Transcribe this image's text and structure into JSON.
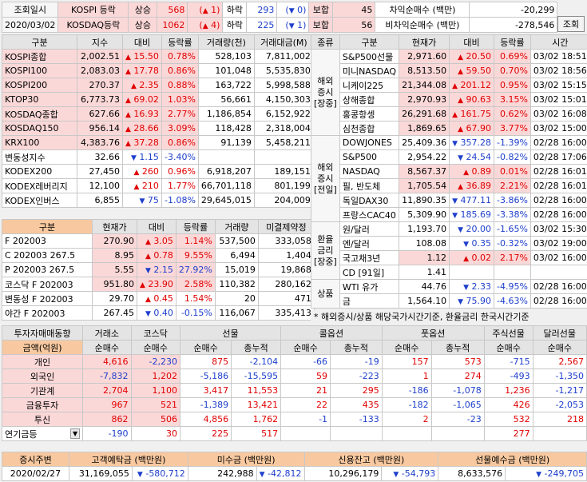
{
  "topbar": {
    "date_label": "조회일시",
    "date_value": "2020/03/02",
    "rows": [
      {
        "name": "KOSPI 등락",
        "up_label": "상승",
        "up": "568",
        "up2": "1",
        "down_label": "하락",
        "down": "293",
        "down2": "0",
        "flat_label": "보합",
        "flat": "45"
      },
      {
        "name": "KOSDAQ등락",
        "up_label": "상승",
        "up": "1062",
        "up2": "4",
        "down_label": "하락",
        "down": "225",
        "down2": "1",
        "flat_label": "보합",
        "flat": "56"
      }
    ],
    "arb1_label": "차익순매수 (백만)",
    "arb1_value": "-20,299",
    "arb2_label": "비차익순매수 (백만)",
    "arb2_value": "-278,546",
    "query_button": "조회"
  },
  "index_table": {
    "headers": [
      "구분",
      "지수",
      "대비",
      "등락률",
      "거래량(천)",
      "거래대금(M)"
    ],
    "rows": [
      {
        "name": "KOSPI종합",
        "value": "2,002.51",
        "dir": "up",
        "chg": "15.50",
        "rate": "0.78%",
        "vol": "528,103",
        "amt": "7,811,002"
      },
      {
        "name": "KOSPI100",
        "value": "2,083.03",
        "dir": "up",
        "chg": "17.78",
        "rate": "0.86%",
        "vol": "101,048",
        "amt": "5,535,830"
      },
      {
        "name": "KOSPI200",
        "value": "270.37",
        "dir": "up",
        "chg": "2.35",
        "rate": "0.88%",
        "vol": "163,722",
        "amt": "5,998,588"
      },
      {
        "name": "KTOP30",
        "value": "6,773.73",
        "dir": "up",
        "chg": "69.02",
        "rate": "1.03%",
        "vol": "56,661",
        "amt": "4,150,303"
      },
      {
        "name": "KOSDAQ종합",
        "value": "627.66",
        "dir": "up",
        "chg": "16.93",
        "rate": "2.77%",
        "vol": "1,186,854",
        "amt": "6,152,922"
      },
      {
        "name": "KOSDAQ150",
        "value": "956.14",
        "dir": "up",
        "chg": "28.66",
        "rate": "3.09%",
        "vol": "118,428",
        "amt": "2,318,004"
      },
      {
        "name": "KRX100",
        "value": "4,383.76",
        "dir": "up",
        "chg": "37.28",
        "rate": "0.86%",
        "vol": "91,139",
        "amt": "5,458,211"
      },
      {
        "name": "변동성지수",
        "value": "32.66",
        "dir": "down",
        "chg": "1.15",
        "rate": "-3.40%",
        "vol": "",
        "amt": ""
      },
      {
        "name": "KODEX200",
        "value": "27,450",
        "dir": "up",
        "chg": "260",
        "rate": "0.96%",
        "vol": "6,918,207",
        "amt": "189,151"
      },
      {
        "name": "KODEX레버리지",
        "value": "12,100",
        "dir": "up",
        "chg": "210",
        "rate": "1.77%",
        "vol": "66,701,118",
        "amt": "801,199"
      },
      {
        "name": "KODEX인버스",
        "value": "6,855",
        "dir": "down",
        "chg": "75",
        "rate": "-1.08%",
        "vol": "29,645,015",
        "amt": "204,009"
      }
    ]
  },
  "futures_table": {
    "headers": [
      "구분",
      "현재가",
      "대비",
      "등락률",
      "거래량",
      "미결제약정"
    ],
    "rows": [
      {
        "name": "F 202003",
        "value": "270.90",
        "dir": "up",
        "chg": "3.05",
        "rate": "1.14%",
        "vol": "537,500",
        "oi": "333,058"
      },
      {
        "name": "C 202003 267.5",
        "value": "8.95",
        "dir": "up",
        "chg": "0.78",
        "rate": "9.55%",
        "vol": "6,494",
        "oi": "1,404"
      },
      {
        "name": "P 202003 267.5",
        "value": "5.55",
        "dir": "down",
        "chg": "2.15",
        "rate": "27.92%",
        "vol": "15,019",
        "oi": "19,868"
      },
      {
        "name": "코스닥 F 202003",
        "value": "951.80",
        "dir": "up",
        "chg": "23.90",
        "rate": "2.58%",
        "vol": "110,382",
        "oi": "280,162"
      },
      {
        "name": "변동성 F 202003",
        "value": "29.70",
        "dir": "up",
        "chg": "0.45",
        "rate": "1.54%",
        "vol": "20",
        "oi": "471"
      },
      {
        "name": "야간 F 202003",
        "value": "267.45",
        "dir": "down",
        "chg": "0.40",
        "rate": "-0.15%",
        "vol": "116,067",
        "oi": "335,413"
      }
    ]
  },
  "world_table": {
    "headers": [
      "종류",
      "구분",
      "현재가",
      "대비",
      "등락률",
      "시간"
    ],
    "groups": [
      {
        "label1": "해외",
        "label2": "증시",
        "label3": "[장중]",
        "rows": [
          {
            "name": "S&P500선물",
            "value": "2,971.60",
            "dir": "up",
            "chg": "20.50",
            "rate": "0.69%",
            "time": "03/02 18:51"
          },
          {
            "name": "미니NASDAQ",
            "value": "8,513.50",
            "dir": "up",
            "chg": "59.50",
            "rate": "0.70%",
            "time": "03/02 18:56"
          },
          {
            "name": "니케이225",
            "value": "21,344.08",
            "dir": "up",
            "chg": "201.12",
            "rate": "0.95%",
            "time": "03/02 15:15"
          },
          {
            "name": "상해종합",
            "value": "2,970.93",
            "dir": "up",
            "chg": "90.63",
            "rate": "3.15%",
            "time": "03/02 15:01"
          },
          {
            "name": "홍콩항셍",
            "value": "26,291.68",
            "dir": "up",
            "chg": "161.75",
            "rate": "0.62%",
            "time": "03/02 16:08"
          },
          {
            "name": "심천종합",
            "value": "1,869.65",
            "dir": "up",
            "chg": "67.90",
            "rate": "3.77%",
            "time": "03/02 15:00"
          }
        ]
      },
      {
        "label1": "해외",
        "label2": "증시",
        "label3": "[전일]",
        "rows": [
          {
            "name": "DOWJONES",
            "value": "25,409.36",
            "dir": "down",
            "chg": "357.28",
            "rate": "-1.39%",
            "time": "02/28 16:00"
          },
          {
            "name": "S&P500",
            "value": "2,954.22",
            "dir": "down",
            "chg": "24.54",
            "rate": "-0.82%",
            "time": "02/28 17:06"
          },
          {
            "name": "NASDAQ",
            "value": "8,567.37",
            "dir": "up",
            "chg": "0.89",
            "rate": "0.01%",
            "time": "02/28 16:01"
          },
          {
            "name": "필, 반도체",
            "value": "1,705.54",
            "dir": "up",
            "chg": "36.89",
            "rate": "2.21%",
            "time": "02/28 16:01"
          },
          {
            "name": "독일DAX30",
            "value": "11,890.35",
            "dir": "down",
            "chg": "477.11",
            "rate": "-3.86%",
            "time": "02/28 16:00"
          },
          {
            "name": "프랑스CAC40",
            "value": "5,309.90",
            "dir": "down",
            "chg": "185.69",
            "rate": "-3.38%",
            "time": "02/28 16:00"
          }
        ]
      },
      {
        "label1": "환율",
        "label2": "금리",
        "label3": "[장중]",
        "rows": [
          {
            "name": "원/달러",
            "value": "1,193.70",
            "dir": "down",
            "chg": "20.00",
            "rate": "-1.65%",
            "time": "03/02 15:30"
          },
          {
            "name": "엔/달러",
            "value": "108.08",
            "dir": "down",
            "chg": "0.35",
            "rate": "-0.32%",
            "time": "03/02 19:00"
          },
          {
            "name": "국고채3년",
            "value": "1.12",
            "dir": "up",
            "chg": "0.02",
            "rate": "2.17%",
            "time": "03/02 16:00"
          },
          {
            "name": "CD [91일]",
            "value": "1.41",
            "dir": "",
            "chg": "",
            "rate": "",
            "time": ""
          }
        ]
      },
      {
        "label1": "상품",
        "label2": "",
        "label3": "",
        "rows": [
          {
            "name": "WTI 유가",
            "value": "44.76",
            "dir": "down",
            "chg": "2.33",
            "rate": "-4.95%",
            "time": "02/28 16:00"
          },
          {
            "name": "금",
            "value": "1,564.10",
            "dir": "down",
            "chg": "75.90",
            "rate": "-4.63%",
            "time": "02/28 16:00"
          }
        ]
      }
    ]
  },
  "note": "* 해외증시/상품 해당국가시간기준, 환율금리 한국시간기준",
  "investor_table": {
    "title": "투자자매매동향",
    "unit": "금액(억원)",
    "col_groups": [
      "거래소",
      "코스닥",
      "선물",
      "콜옵션",
      "풋옵션",
      "주식선물",
      "달러선물"
    ],
    "sub_headers": [
      "순매수",
      "순매수",
      "순매수",
      "총누적",
      "순매수",
      "총누적",
      "순매수",
      "총누적",
      "순매수",
      "순매수"
    ],
    "rows": [
      {
        "name": "개인",
        "v": [
          "4,616",
          "-2,230",
          "875",
          "-2,104",
          "-66",
          "-19",
          "157",
          "573",
          "-715",
          "2,567"
        ]
      },
      {
        "name": "외국인",
        "v": [
          "-7,832",
          "1,202",
          "-5,186",
          "-15,595",
          "59",
          "-223",
          "1",
          "274",
          "-493",
          "-1,350"
        ]
      },
      {
        "name": "기관계",
        "v": [
          "2,704",
          "1,100",
          "3,417",
          "11,553",
          "21",
          "295",
          "-186",
          "-1,078",
          "1,236",
          "-1,217"
        ]
      },
      {
        "name": "금융투자",
        "v": [
          "967",
          "521",
          "-1,389",
          "13,421",
          "22",
          "435",
          "-182",
          "-1,065",
          "426",
          "-2,053"
        ]
      },
      {
        "name": "투신",
        "v": [
          "862",
          "506",
          "4,856",
          "1,762",
          "-1",
          "-133",
          "2",
          "-23",
          "532",
          "218"
        ]
      },
      {
        "name": "연기금등",
        "v": [
          "-190",
          "30",
          "225",
          "517",
          "",
          "",
          "",
          "",
          "277",
          ""
        ]
      }
    ]
  },
  "bottom_table": {
    "headers": [
      "증시주변",
      "고객예탁금 (백만원)",
      "미수금 (백만원)",
      "신용잔고 (백만원)",
      "선물예수금 (백만원)"
    ],
    "date": "2020/02/27",
    "values": [
      {
        "v": "31,169,055",
        "c": "-580,712"
      },
      {
        "v": "242,988",
        "c": "-42,812"
      },
      {
        "v": "10,296,179",
        "c": "-54,793"
      },
      {
        "v": "8,633,576",
        "c": "-249,705"
      }
    ]
  },
  "colors": {
    "up": "#e00000",
    "down": "#1e3fcc",
    "pink": "#fbd8d8",
    "orange_header": "#f8c9a0"
  }
}
